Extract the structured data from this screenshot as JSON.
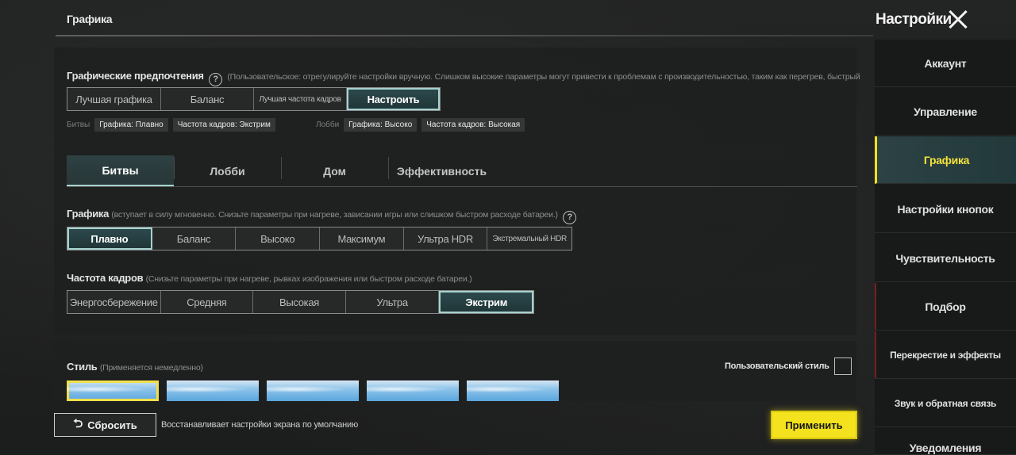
{
  "header": {
    "section_title": "Графика",
    "settings_title": "Настройки"
  },
  "preferences": {
    "label": "Графические предпочтения",
    "hint": "(Пользовательское: отрегулируйте настройки вручную. Слишком высокие параметры могут привести к проблемам с производительностью, таким как перегрев, быстрый",
    "options": [
      "Лучшая графика",
      "Баланс",
      "Лучшая частота кадров",
      "Настроить"
    ],
    "selected": "Настроить",
    "battles_label": "Битвы",
    "battles_graphics": "Графика: Плавно",
    "battles_fps": "Частота кадров: Экстрим",
    "lobby_label": "Лобби",
    "lobby_graphics": "Графика: Высоко",
    "lobby_fps": "Частота кадров: Высокая"
  },
  "tabs": [
    "Битвы",
    "Лобби",
    "Дом",
    "Эффективность"
  ],
  "active_tab": "Битвы",
  "graphics": {
    "label": "Графика",
    "hint": "(вступает в силу мгновенно. Снизьте параметры при нагреве, зависании игры или слишком быстром расходе батареи.)",
    "options": [
      "Плавно",
      "Баланс",
      "Высоко",
      "Максимум",
      "Ультра HDR",
      "Экстремальный HDR"
    ],
    "selected": "Плавно"
  },
  "fps": {
    "label": "Частота кадров",
    "hint": "(Снизьте параметры при нагреве, рывках изображения или быстром расходе батареи.)",
    "options": [
      "Энергосбережение",
      "Средняя",
      "Высокая",
      "Ультра",
      "Экстрим"
    ],
    "selected": "Экстрим"
  },
  "style": {
    "label": "Стиль",
    "hint": "(Применяется немедленно)",
    "custom_label": "Пользовательский стиль",
    "selected_index": 0
  },
  "footer": {
    "reset_label": "Сбросить",
    "reset_desc": "Восстанавливает настройки экрана по умолчанию",
    "apply_label": "Применить"
  },
  "sidebar": {
    "items": [
      "Аккаунт",
      "Управление",
      "Графика",
      "Настройки кнопок",
      "Чувствительность",
      "Подбор",
      "Перекрестие и эффекты",
      "Звук и обратная связь",
      "Уведомления"
    ],
    "active": "Графика"
  },
  "colors": {
    "accent_teal": "#a6d3cf",
    "accent_yellow": "#f3e21d"
  }
}
